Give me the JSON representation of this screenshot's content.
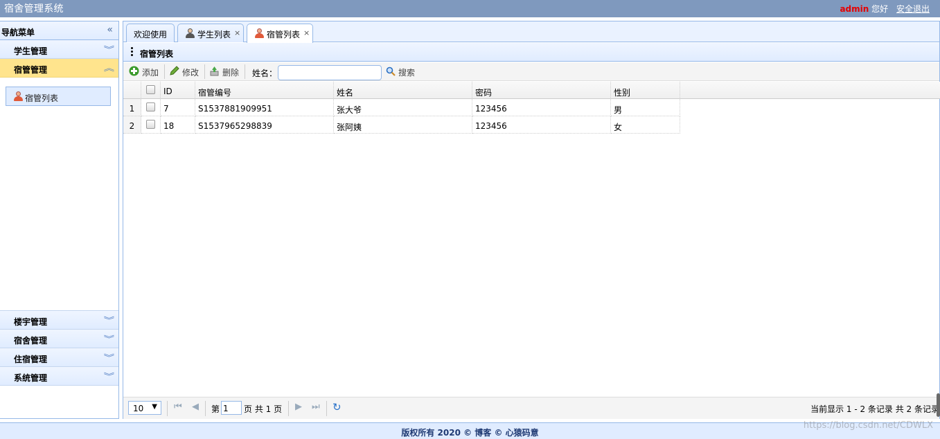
{
  "app": {
    "title": "宿舍管理系统"
  },
  "header": {
    "user": "admin",
    "greeting": "您好",
    "logout": "安全退出"
  },
  "nav": {
    "title": "导航菜单",
    "sections": [
      {
        "label": "学生管理"
      },
      {
        "label": "宿管管理",
        "items": [
          {
            "label": "宿管列表"
          }
        ]
      },
      {
        "label": "楼宇管理"
      },
      {
        "label": "宿舍管理"
      },
      {
        "label": "住宿管理"
      },
      {
        "label": "系统管理"
      }
    ]
  },
  "tabs": [
    {
      "label": "欢迎使用"
    },
    {
      "label": "学生列表",
      "close": "×"
    },
    {
      "label": "宿管列表",
      "close": "×",
      "active": true
    }
  ],
  "panel": {
    "title": "宿管列表"
  },
  "toolbar": {
    "add": "添加",
    "edit": "修改",
    "delete": "删除",
    "name_label": "姓名：",
    "name_value": "",
    "search": "搜索"
  },
  "grid": {
    "columns": [
      "ID",
      "宿管编号",
      "姓名",
      "密码",
      "性别"
    ],
    "rows": [
      {
        "num": "1",
        "id": "7",
        "code": "S1537881909951",
        "name": "张大爷",
        "password": "123456",
        "gender": "男"
      },
      {
        "num": "2",
        "id": "18",
        "code": "S1537965298839",
        "name": "张阿姨",
        "password": "123456",
        "gender": "女"
      }
    ]
  },
  "pager": {
    "page_size": "10",
    "page_prefix": "第",
    "page_value": "1",
    "page_suffix": "页 共 1 页",
    "info": "当前显示 1 - 2 条记录 共 2 条记录"
  },
  "footer": {
    "copyright": "版权所有 2020 © 博客 © 心猿码意"
  },
  "watermark": "https://blog.csdn.net/CDWLX"
}
